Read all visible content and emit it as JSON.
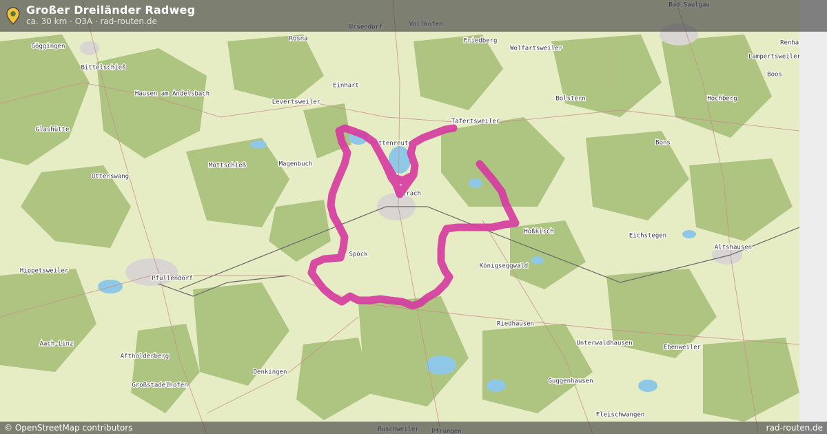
{
  "header": {
    "title": "Großer Dreiländer Radweg",
    "subtitle": "ca. 30 km · O3A · rad-routen.de",
    "icon": "map-pin-icon"
  },
  "footer": {
    "attribution": "© OpenStreetMap contributors",
    "brand": "rad-routen.de"
  },
  "map": {
    "route_color": "#d63aa0",
    "places": [
      "Bad Saulgau",
      "Renhardsweiler",
      "Ursendorf",
      "Völlkofen",
      "Rosna",
      "Göggingen",
      "Friedberg",
      "Wolfartsweiler",
      "Lampertsweiler",
      "Bittelschieß",
      "Boos",
      "Einhart",
      "Hausen am Andelsbach",
      "Bolstern",
      "Levertsweiler",
      "Hochberg",
      "Glashütte",
      "Tafertsweiler",
      "Ostrach",
      "Bettenreute",
      "Magenbuch",
      "Mottschieß",
      "Bons",
      "Otterswang",
      "Hoßkirch",
      "Eichstegen",
      "Altshausen",
      "Spöck",
      "Königseggwald",
      "Hippetsweiler",
      "Pfullendorf",
      "Riedhausen",
      "Aach-Linz",
      "Unterwaldhausen",
      "Ebenweiler",
      "Aftholderberg",
      "Denkingen",
      "Guggenhausen",
      "Großstadelhofen",
      "Fleischwangen",
      "Ruschweiler",
      "Pfrungen"
    ]
  }
}
